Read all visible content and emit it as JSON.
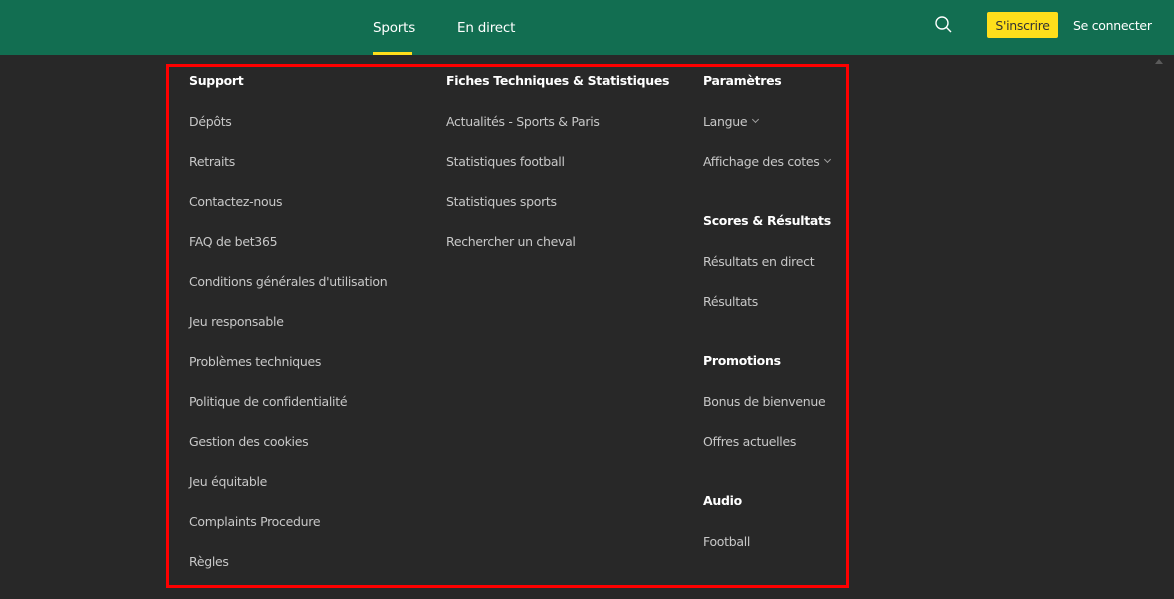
{
  "header": {
    "tabs": [
      {
        "label": "Sports",
        "active": true
      },
      {
        "label": "En direct",
        "active": false
      }
    ],
    "search_icon": "search-icon",
    "join_label": "S'inscrire",
    "login_label": "Se connecter",
    "colors": {
      "header_bg": "#126e51",
      "accent_yellow": "#ffdf1b",
      "page_bg": "#282828",
      "highlight_border": "#ff0000"
    }
  },
  "menu": {
    "support": {
      "heading": "Support",
      "items": [
        "Dépôts",
        "Retraits",
        "Contactez-nous",
        "FAQ de bet365",
        "Conditions générales d'utilisation",
        "Jeu responsable",
        "Problèmes techniques",
        "Politique de confidentialité",
        "Gestion des cookies",
        "Jeu équitable",
        "Complaints Procedure",
        "Règles"
      ]
    },
    "stats": {
      "heading": "Fiches Techniques & Statistiques",
      "items": [
        "Actualités - Sports & Paris",
        "Statistiques football",
        "Statistiques sports",
        "Rechercher un cheval"
      ]
    },
    "settings": {
      "heading": "Paramètres",
      "items": [
        "Langue",
        "Affichage des cotes"
      ]
    },
    "scores": {
      "heading": "Scores & Résultats",
      "items": [
        "Résultats en direct",
        "Résultats"
      ]
    },
    "promotions": {
      "heading": "Promotions",
      "items": [
        "Bonus de bienvenue",
        "Offres actuelles"
      ]
    },
    "audio": {
      "heading": "Audio",
      "items": [
        "Football"
      ]
    }
  }
}
